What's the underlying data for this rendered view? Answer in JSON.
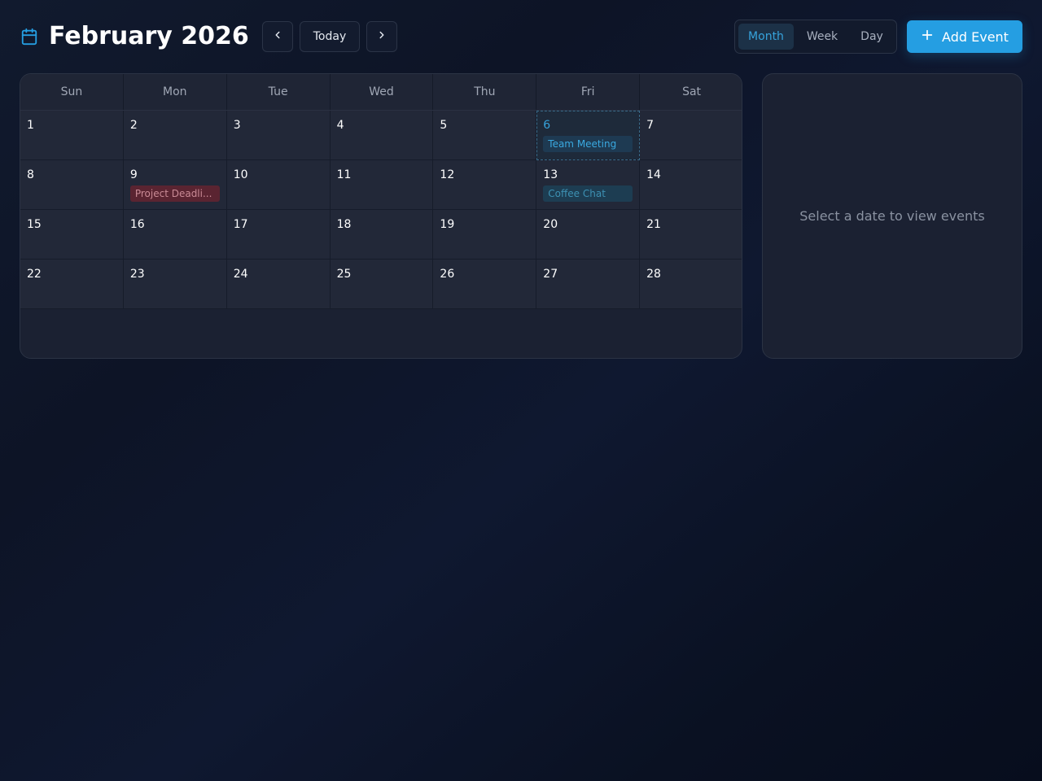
{
  "header": {
    "title": "February 2026",
    "icon": "calendar-icon",
    "today_label": "Today",
    "views": [
      "Month",
      "Week",
      "Day"
    ],
    "active_view": "Month",
    "add_event_label": "Add Event"
  },
  "calendar": {
    "days_of_week": [
      "Sun",
      "Mon",
      "Tue",
      "Wed",
      "Thu",
      "Fri",
      "Sat"
    ],
    "today": 6,
    "weeks": [
      [
        1,
        2,
        3,
        4,
        5,
        6,
        7
      ],
      [
        8,
        9,
        10,
        11,
        12,
        13,
        14
      ],
      [
        15,
        16,
        17,
        18,
        19,
        20,
        21
      ],
      [
        22,
        23,
        24,
        25,
        26,
        27,
        28
      ]
    ],
    "events": [
      {
        "day": 6,
        "title": "Team Meeting",
        "color": "#3aa9e0"
      },
      {
        "day": 9,
        "title": "Project Deadli...",
        "color": "#c98a95"
      },
      {
        "day": 13,
        "title": "Coffee Chat",
        "color": "#3d91b3"
      }
    ]
  },
  "side_panel": {
    "empty_message": "Select a date to view events"
  },
  "colors": {
    "accent": "#259ee2",
    "background": "#0d1426",
    "panel": "#1b2132"
  }
}
